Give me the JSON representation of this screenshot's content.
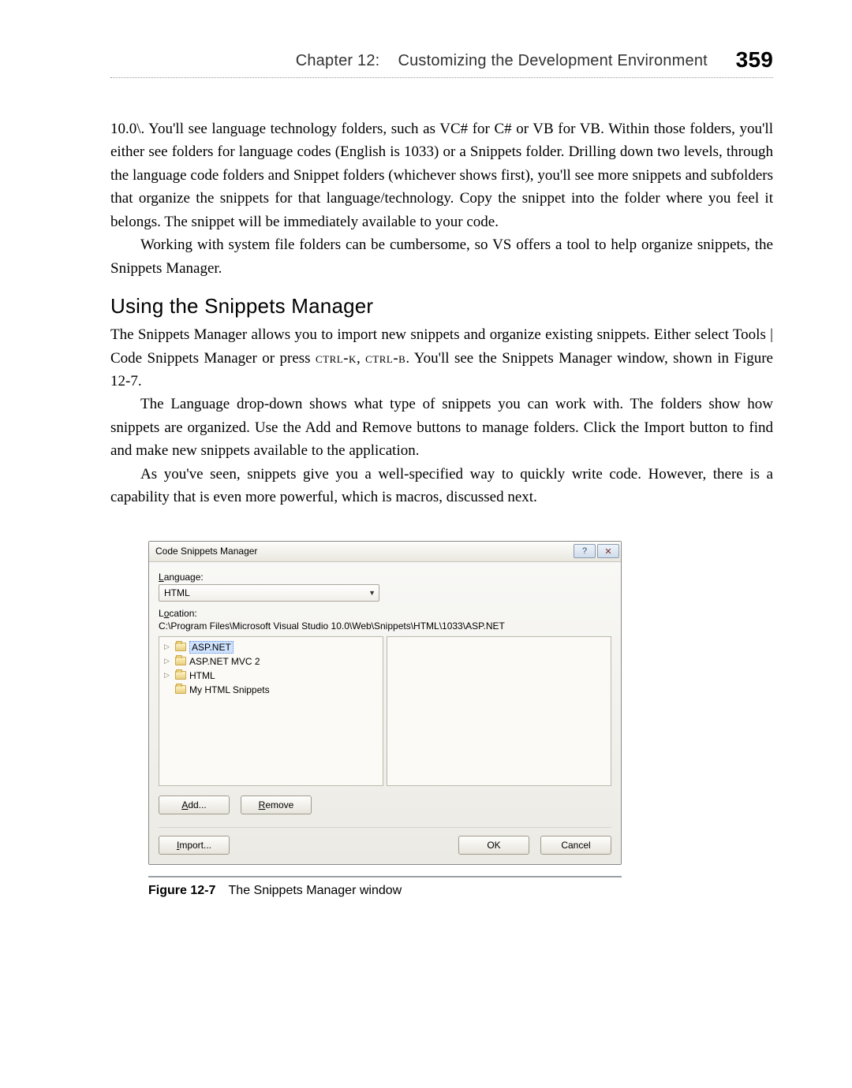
{
  "header": {
    "chapter": "Chapter 12:",
    "title": "Customizing the Development Environment",
    "page": "359"
  },
  "paragraphs": {
    "p1": "10.0\\. You'll see language technology folders, such as VC# for C# or VB for VB. Within those folders, you'll either see folders for language codes (English is 1033) or a Snippets folder. Drilling down two levels, through the language code folders and Snippet folders (whichever shows first), you'll see more snippets and subfolders that organize the snippets for that language/technology. Copy the snippet into the folder where you feel it belongs. The snippet will be immediately available to your code.",
    "p2": "Working with system file folders can be cumbersome, so VS offers a tool to help organize snippets, the Snippets Manager.",
    "h3": "Using the Snippets Manager",
    "p3a": "The Snippets Manager allows you to import new snippets and organize existing snippets. Either select Tools | Code Snippets Manager or press ",
    "p3k1": "ctrl-k",
    "p3mid": ", ",
    "p3k2": "ctrl-b",
    "p3b": ". You'll see the Snippets Manager window, shown in Figure 12-7.",
    "p4": "The Language drop-down shows what type of snippets you can work with. The folders show how snippets are organized. Use the Add and Remove buttons to manage folders. Click the Import button to find and make new snippets available to the application.",
    "p5": "As you've seen, snippets give you a well-specified way to quickly write code. However, there is a capability that is even more powerful, which is macros, discussed next."
  },
  "dialog": {
    "title": "Code Snippets Manager",
    "help": "?",
    "close": "✕",
    "language_label": "Language:",
    "language_value": "HTML",
    "location_label": "Location:",
    "location_path": "C:\\Program Files\\Microsoft Visual Studio 10.0\\Web\\Snippets\\HTML\\1033\\ASP.NET",
    "tree": {
      "n0": "ASP.NET",
      "n1": "ASP.NET MVC 2",
      "n2": "HTML",
      "n3": "My HTML Snippets"
    },
    "buttons": {
      "add_u": "A",
      "add_rest": "dd...",
      "remove_u": "R",
      "remove_rest": "emove",
      "import_u": "I",
      "import_rest": "mport...",
      "ok": "OK",
      "cancel": "Cancel"
    }
  },
  "caption": {
    "label": "Figure 12-7",
    "text": "The Snippets Manager window"
  }
}
